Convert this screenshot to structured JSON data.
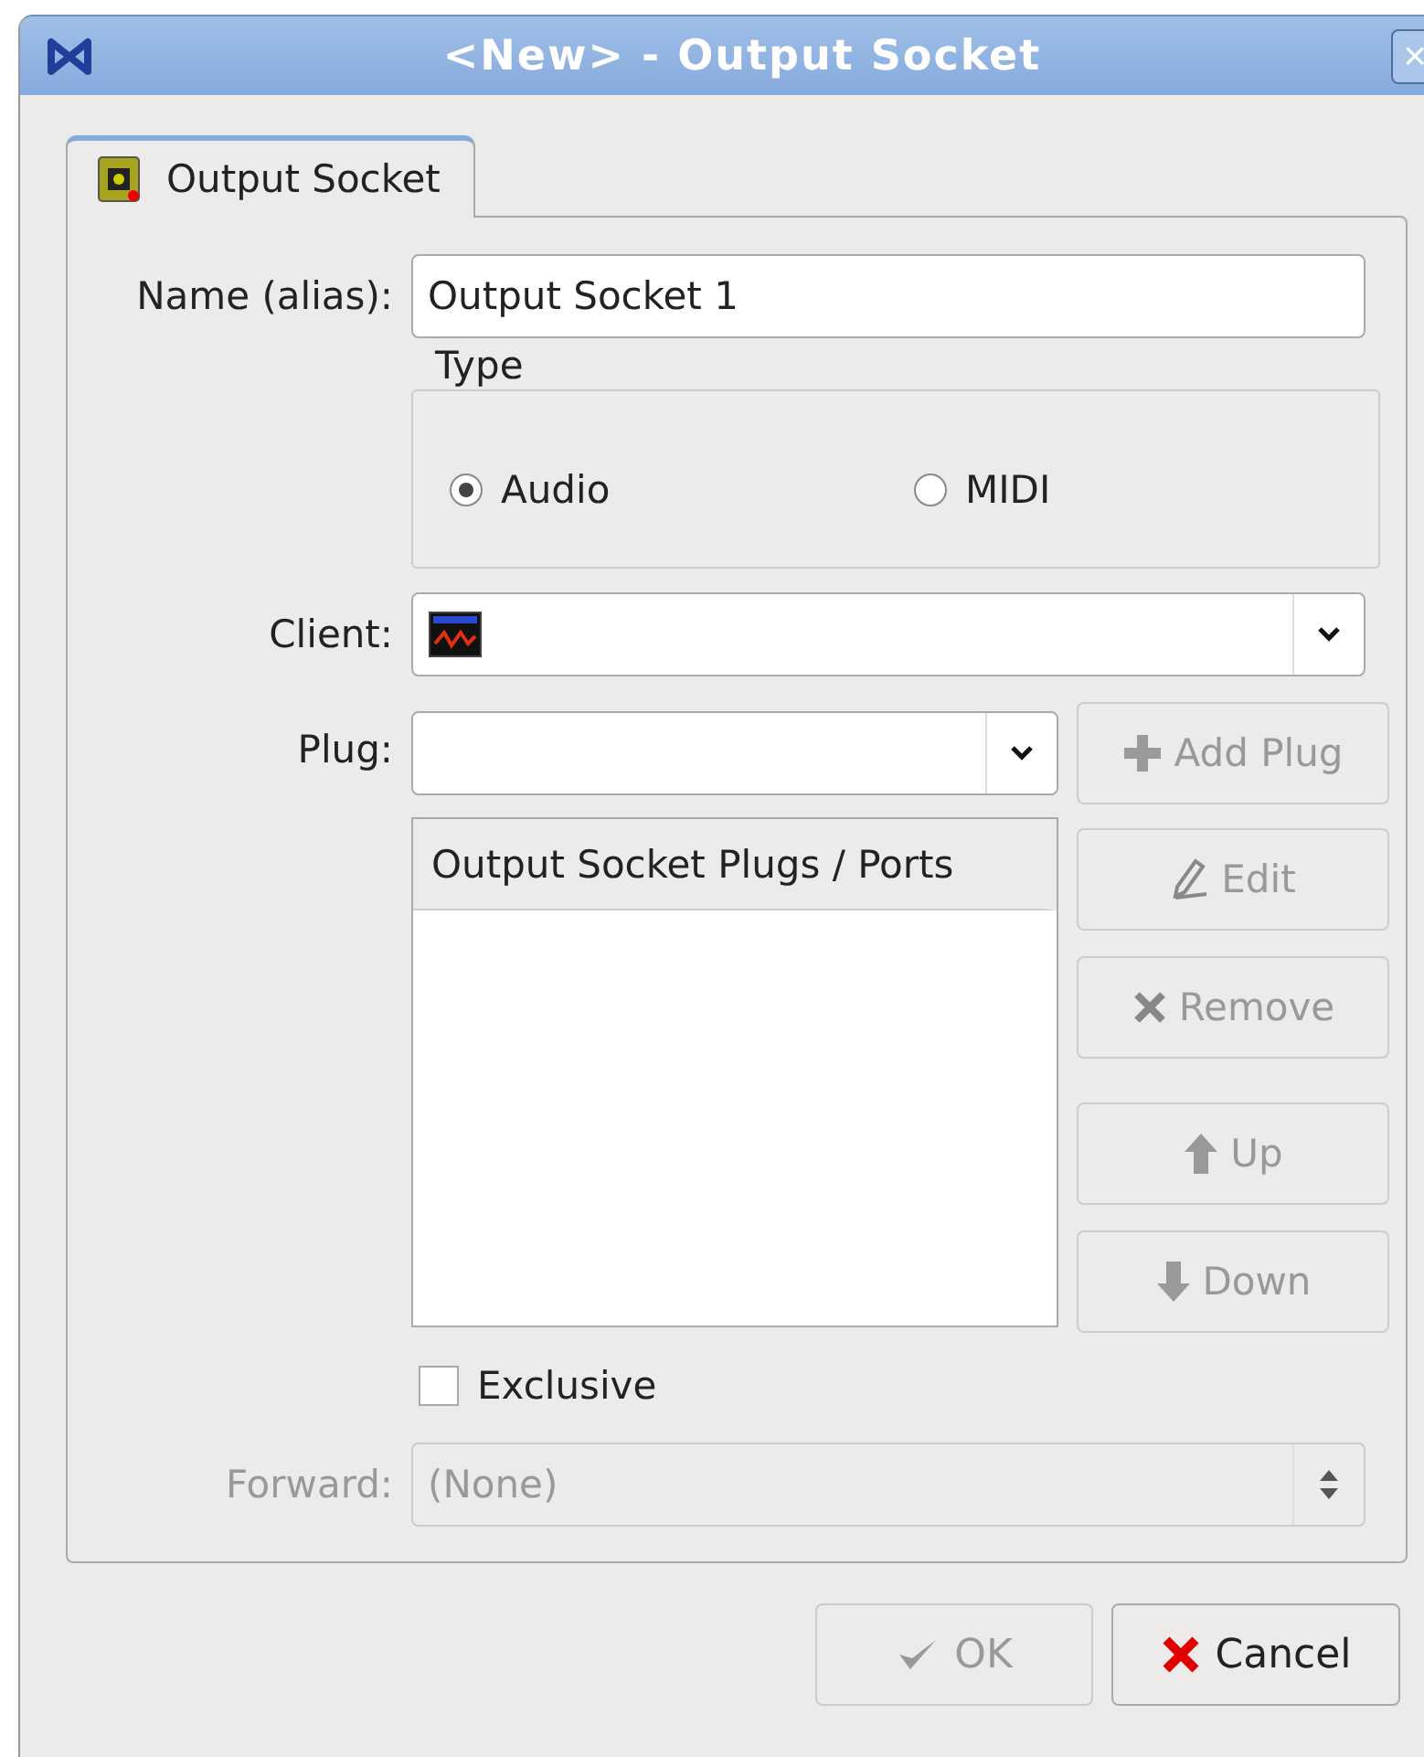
{
  "window": {
    "title": "<New> - Output Socket",
    "close": "×"
  },
  "tabs": [
    {
      "label": "Output Socket",
      "selected": true
    }
  ],
  "name_field": {
    "label": {
      "text": "Name (alias):"
    },
    "value": "Output Socket 1"
  },
  "type_group": {
    "title": "Type",
    "options": [
      {
        "label": {
          "text": "Audio"
        },
        "selected": true
      },
      {
        "label": {
          "text": "MIDI"
        },
        "selected": false
      }
    ]
  },
  "client": {
    "label": {
      "text": "Client:"
    }
  },
  "plug": {
    "label": {
      "text": "Plug:"
    }
  },
  "plug_list": {
    "columns": [
      "Output Socket Plugs / Ports"
    ]
  },
  "side_buttons": [
    {
      "kind": "add",
      "label": {
        "text": "Add Plug"
      },
      "disabled": true
    },
    {
      "kind": "edit",
      "label": {
        "text": "Edit"
      },
      "disabled": true
    },
    {
      "kind": "remove",
      "label": {
        "text": "Remove"
      },
      "disabled": true
    },
    {
      "kind": "up",
      "label": {
        "text": "Up"
      },
      "disabled": true
    },
    {
      "kind": "down",
      "label": {
        "text": "Down"
      },
      "disabled": true
    }
  ],
  "exclusive": {
    "label": {
      "text": "Exclusive"
    },
    "checked": false
  },
  "forward": {
    "label": {
      "text": "Forward:"
    },
    "value": "(None)",
    "disabled": true
  },
  "buttons": [
    {
      "kind": "ok",
      "label": "OK",
      "disabled": true
    },
    {
      "kind": "cancel",
      "label": "Cancel",
      "disabled": false
    }
  ]
}
